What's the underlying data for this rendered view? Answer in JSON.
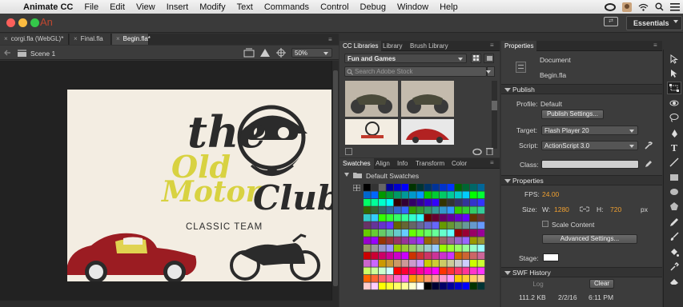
{
  "menubar": {
    "app_name": "Animate CC",
    "items": [
      "File",
      "Edit",
      "View",
      "Insert",
      "Modify",
      "Text",
      "Commands",
      "Control",
      "Debug",
      "Window",
      "Help"
    ]
  },
  "titlebar": {
    "app_badge": "An",
    "workspace": "Essentials"
  },
  "doc_tabs": [
    {
      "label": "corgi.fla (WebGL)*",
      "close": "×"
    },
    {
      "label": "Final.fla",
      "close": "×"
    },
    {
      "label": "Begin.fla*",
      "close": "×"
    }
  ],
  "editbar": {
    "scene": "Scene 1",
    "zoom": "50%"
  },
  "stage_art": {
    "line1": "the",
    "line2": "Old",
    "line3": "Motor",
    "line4": "Club",
    "tagline": "CLASSIC TEAM"
  },
  "library_panel": {
    "tabs": [
      "CC Libraries",
      "Library",
      "Brush Library"
    ],
    "library_select": "Fun and Games",
    "search_placeholder": "Search Adobe Stock"
  },
  "swatches_panel": {
    "tabs": [
      "Swatches",
      "Align",
      "Info",
      "Transform",
      "Color"
    ],
    "folder": "Default Swatches"
  },
  "properties": {
    "tab": "Properties",
    "doc_type": "Document",
    "doc_name": "Begin.fla",
    "publish_section": "Publish",
    "profile_label": "Profile:",
    "profile_value": "Default",
    "publish_settings_btn": "Publish Settings...",
    "target_label": "Target:",
    "target_value": "Flash Player 20",
    "script_label": "Script:",
    "script_value": "ActionScript 3.0",
    "class_label": "Class:",
    "class_value": "",
    "properties_section": "Properties",
    "fps_label": "FPS:",
    "fps_value": "24.00",
    "size_label": "Size:",
    "w_label": "W:",
    "w_value": "1280",
    "h_label": "H:",
    "h_value": "720",
    "unit": "px",
    "scale_content": "Scale Content",
    "advanced_btn": "Advanced Settings...",
    "stage_label": "Stage:",
    "stage_color": "#ffffff",
    "swf_section": "SWF History",
    "log_btn": "Log",
    "clear_btn": "Clear",
    "history_size": "111.2 KB",
    "history_date": "2/2/16",
    "history_time": "6:11 PM"
  },
  "colors": {
    "accent_orange": "#f0a030",
    "panel_bg": "#3c3c3c",
    "stage_bg": "#f3ede2",
    "logo_yellow": "#d8d241",
    "car_red": "#9b1c22"
  }
}
